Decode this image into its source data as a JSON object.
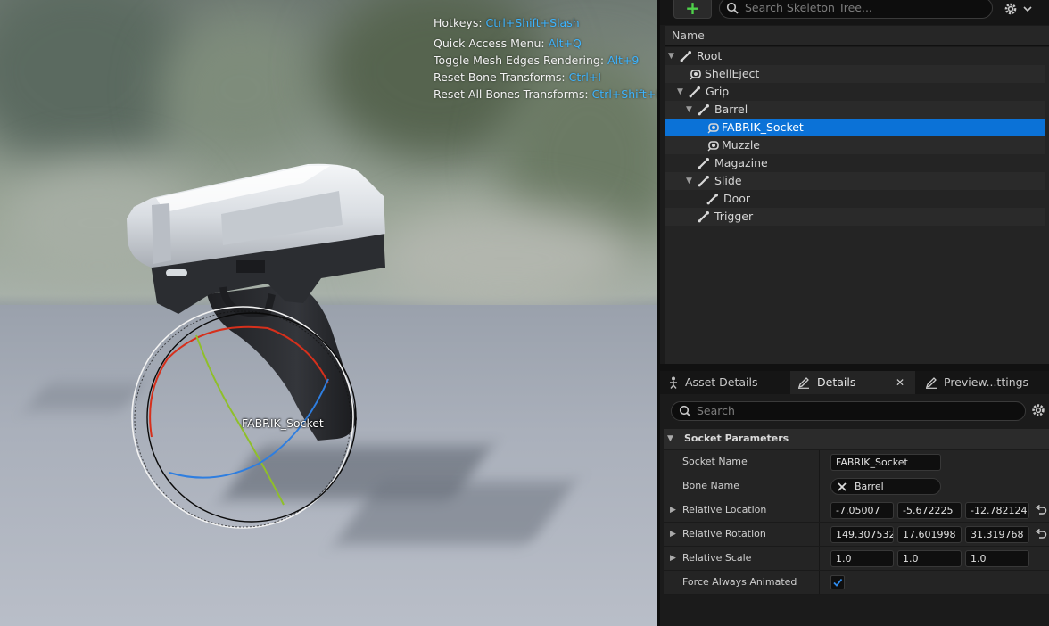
{
  "viewport": {
    "hotkeys": [
      {
        "label": "Hotkeys:",
        "key": "Ctrl+Shift+Slash"
      },
      {
        "label": "Quick Access Menu:",
        "key": "Alt+Q"
      },
      {
        "label": "Toggle Mesh Edges Rendering:",
        "key": "Alt+9"
      },
      {
        "label": "Reset Bone Transforms:",
        "key": "Ctrl+I"
      },
      {
        "label": "Reset All Bones Transforms:",
        "key": "Ctrl+Shift+I"
      }
    ],
    "socket_label": "FABRIK_Socket",
    "gizmo_colors": {
      "x": "#d6301c",
      "y": "#8fbf2a",
      "z": "#2e7ee0"
    }
  },
  "skeleton_tree": {
    "add_button_icon": "plus-icon",
    "search_placeholder": "Search Skeleton Tree...",
    "column_header": "Name",
    "nodes": [
      {
        "label": "Root",
        "type": "bone",
        "expanded": true
      },
      {
        "label": "ShellEject",
        "type": "socket"
      },
      {
        "label": "Grip",
        "type": "bone",
        "expanded": true
      },
      {
        "label": "Barrel",
        "type": "bone",
        "expanded": true
      },
      {
        "label": "FABRIK_Socket",
        "type": "socket",
        "selected": true
      },
      {
        "label": "Muzzle",
        "type": "socket"
      },
      {
        "label": "Magazine",
        "type": "bone"
      },
      {
        "label": "Slide",
        "type": "bone",
        "expanded": true
      },
      {
        "label": "Door",
        "type": "bone"
      },
      {
        "label": "Trigger",
        "type": "bone"
      }
    ]
  },
  "tabs": [
    {
      "label": "Asset Details",
      "icon": "skeleton-icon"
    },
    {
      "label": "Details",
      "icon": "pencil-icon",
      "active": true
    },
    {
      "label": "Preview...ttings",
      "icon": "pencil-icon"
    }
  ],
  "details": {
    "search_placeholder": "Search",
    "section_title": "Socket Parameters",
    "socket_name_label": "Socket Name",
    "socket_name_value": "FABRIK_Socket",
    "bone_name_label": "Bone Name",
    "bone_name_value": "Barrel",
    "relative_location_label": "Relative Location",
    "relative_location": [
      "-7.05007",
      "-5.672225",
      "-12.782124"
    ],
    "relative_rotation_label": "Relative Rotation",
    "relative_rotation": [
      "149.307532",
      "17.601998",
      "31.319768"
    ],
    "relative_scale_label": "Relative Scale",
    "relative_scale": [
      "1.0",
      "1.0",
      "1.0"
    ],
    "force_animated_label": "Force Always Animated",
    "force_animated_checked": true
  },
  "colors": {
    "selection": "#0b72d7",
    "key_text": "#3db4ff",
    "add_green": "#4fd14a"
  }
}
